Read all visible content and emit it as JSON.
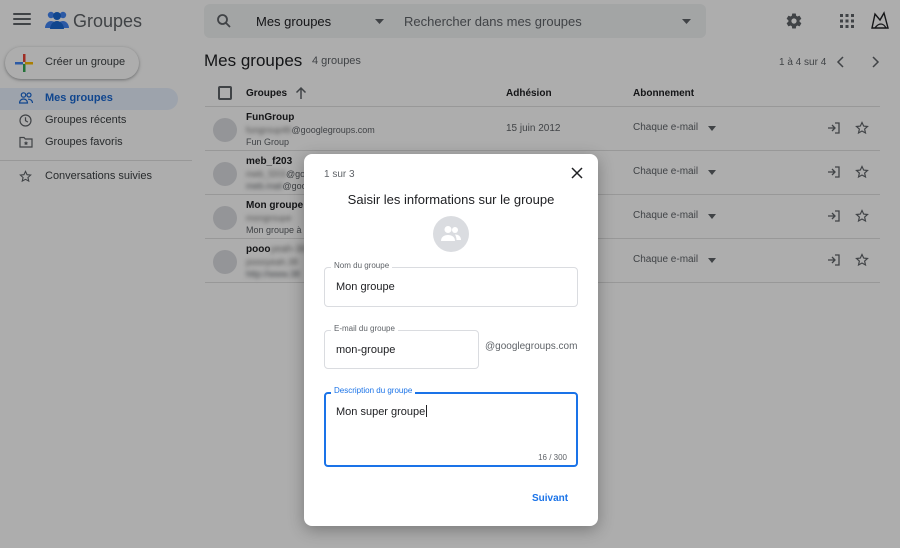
{
  "header": {
    "app_title": "Groupes",
    "search_scope": "Mes groupes",
    "search_placeholder": "Rechercher dans mes groupes",
    "icons": [
      "menu-icon",
      "groups-logo-icon",
      "search-icon",
      "settings-icon",
      "apps-icon",
      "avatar"
    ]
  },
  "sidebar": {
    "create_label": "Créer un groupe",
    "items": [
      {
        "label": "Mes groupes",
        "icon": "people-icon",
        "active": true
      },
      {
        "label": "Groupes récents",
        "icon": "clock-icon",
        "active": false
      },
      {
        "label": "Groupes favoris",
        "icon": "folder-star-icon",
        "active": false
      },
      {
        "label": "Conversations suivies",
        "icon": "star-icon",
        "active": false
      }
    ]
  },
  "main": {
    "title": "Mes groupes",
    "count": "4 groupes",
    "pagination": "1 à 4 sur 4",
    "columns": {
      "groups": "Groupes",
      "joined": "Adhésion",
      "subscription": "Abonnement"
    },
    "rows": [
      {
        "name": "FunGroup",
        "email_blur": "fungroup46",
        "email_visible": "@googlegroups.com",
        "desc": "Fun Group",
        "joined": "15 juin 2012",
        "subscription": "Chaque e-mail"
      },
      {
        "name": "meb_f203",
        "email_blur": "meb_f203",
        "email_visible": "@goo",
        "desc_blur": "meb.mail",
        "desc_visible": "@goo",
        "joined": "",
        "subscription": "Chaque e-mail"
      },
      {
        "name": "Mon groupe",
        "email_blur": "mongroupe",
        "email_visible": "",
        "desc": "Mon groupe à",
        "joined": "",
        "subscription": "Chaque e-mail"
      },
      {
        "name_visible": "pooo",
        "name_blur": "yeah-38",
        "email_blur": "poooyeah.38",
        "email_visible": "",
        "desc_blur": "http://www.38",
        "joined": "",
        "subscription": "Chaque e-mail"
      }
    ]
  },
  "dialog": {
    "step": "1 sur 3",
    "title": "Saisir les informations sur le groupe",
    "name_label": "Nom du groupe",
    "name_value": "Mon groupe",
    "email_label": "E-mail du groupe",
    "email_value": "mon-groupe",
    "email_suffix": "@googlegroups.com",
    "desc_label": "Description du groupe",
    "desc_value": "Mon super groupe",
    "desc_counter": "16 / 300",
    "next_label": "Suivant",
    "colors": {
      "accent": "#1a73e8",
      "scrim": "rgba(0,0,0,0.32)"
    }
  }
}
